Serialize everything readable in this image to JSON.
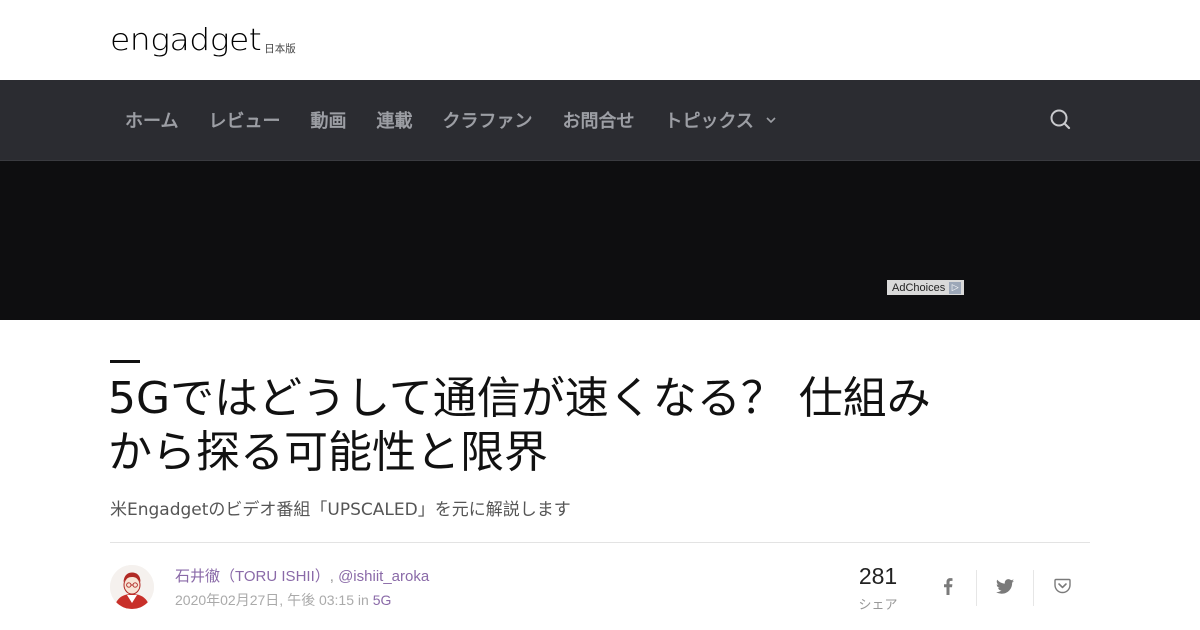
{
  "header": {
    "logo_text": "engadget",
    "edition_label": "日本版"
  },
  "nav": {
    "items": [
      "ホーム",
      "レビュー",
      "動画",
      "連載",
      "クラファン",
      "お問合せ",
      "トピックス"
    ],
    "search_icon": "search-icon",
    "topics_icon": "chevron-down-icon"
  },
  "ad": {
    "adchoices_label": "AdChoices",
    "adchoices_icon": "adchoices-triangle-icon"
  },
  "article": {
    "title": "5Gではどうして通信が速くなる？ 仕組みから探る可能性と限界",
    "subtitle": "米Engadgetのビデオ番組「UPSCALED」を元に解説します"
  },
  "byline": {
    "author": "石井徹（TORU ISHII）",
    "separator": ",",
    "twitter": "@ishiit_aroka",
    "date": "2020年02月27日, 午後 03:15",
    "in_word": "in",
    "category": "5G"
  },
  "share": {
    "count": "281",
    "label": "シェア",
    "buttons": [
      "facebook-icon",
      "twitter-icon",
      "pocket-icon"
    ]
  },
  "colors": {
    "nav_bg": "#2b2c31",
    "nav_text": "#9c9ea4",
    "ad_bg": "#0e0e10",
    "link_purple": "#8a6aa8"
  }
}
